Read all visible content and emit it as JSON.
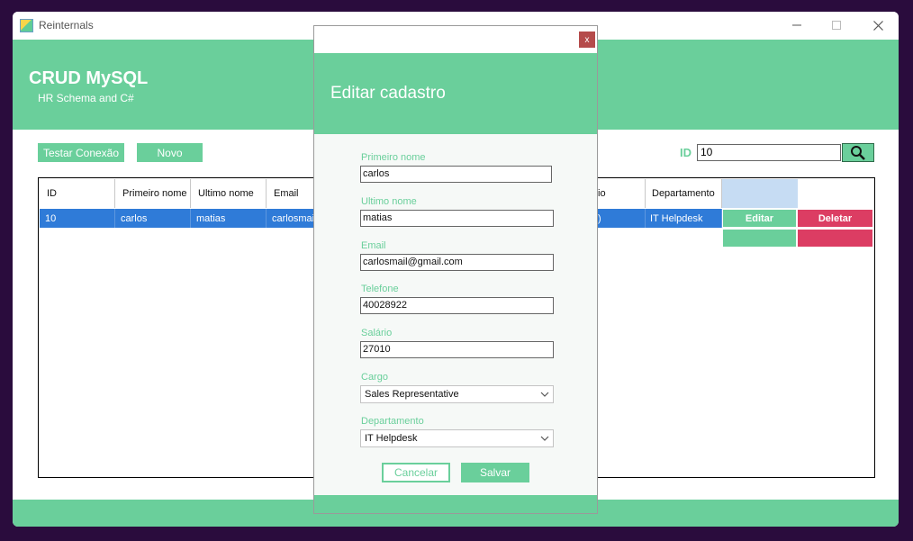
{
  "window": {
    "title": "Reinternals",
    "minimize_icon": "minimize-icon",
    "maximize_icon": "maximize-icon",
    "close_icon": "close-icon"
  },
  "header": {
    "title": "CRUD MySQL",
    "subtitle": "HR Schema and C#"
  },
  "toolbar": {
    "test_connection": "Testar Conexão",
    "new": "Novo",
    "id_label": "ID",
    "id_value": "10",
    "search_icon": "search-icon"
  },
  "grid": {
    "columns": [
      "ID",
      "Primeiro nome",
      "Ultimo nome",
      "Email",
      "io",
      "Departamento"
    ],
    "row": {
      "id": "10",
      "first": "carlos",
      "last": "matias",
      "email": "carlosmail@",
      "partial": ")",
      "dept": "IT Helpdesk"
    },
    "edit_label": "Editar",
    "delete_label": "Deletar"
  },
  "dialog": {
    "close_label": "x",
    "title": "Editar cadastro",
    "first_name_label": "Primeiro nome",
    "first_name": "carlos",
    "last_name_label": "Ultimo nome",
    "last_name": "matias",
    "email_label": "Email",
    "email": "carlosmail@gmail.com",
    "phone_label": "Telefone",
    "phone": "40028922",
    "salary_label": "Salário",
    "salary": "27010",
    "job_label": "Cargo",
    "job": "Sales Representative",
    "dept_label": "Departamento",
    "dept": "IT Helpdesk",
    "cancel": "Cancelar",
    "save": "Salvar"
  },
  "colors": {
    "accent": "#6acf9b",
    "selection": "#2f7bd8",
    "delete": "#dc3d63",
    "background": "#2a0c3d"
  }
}
